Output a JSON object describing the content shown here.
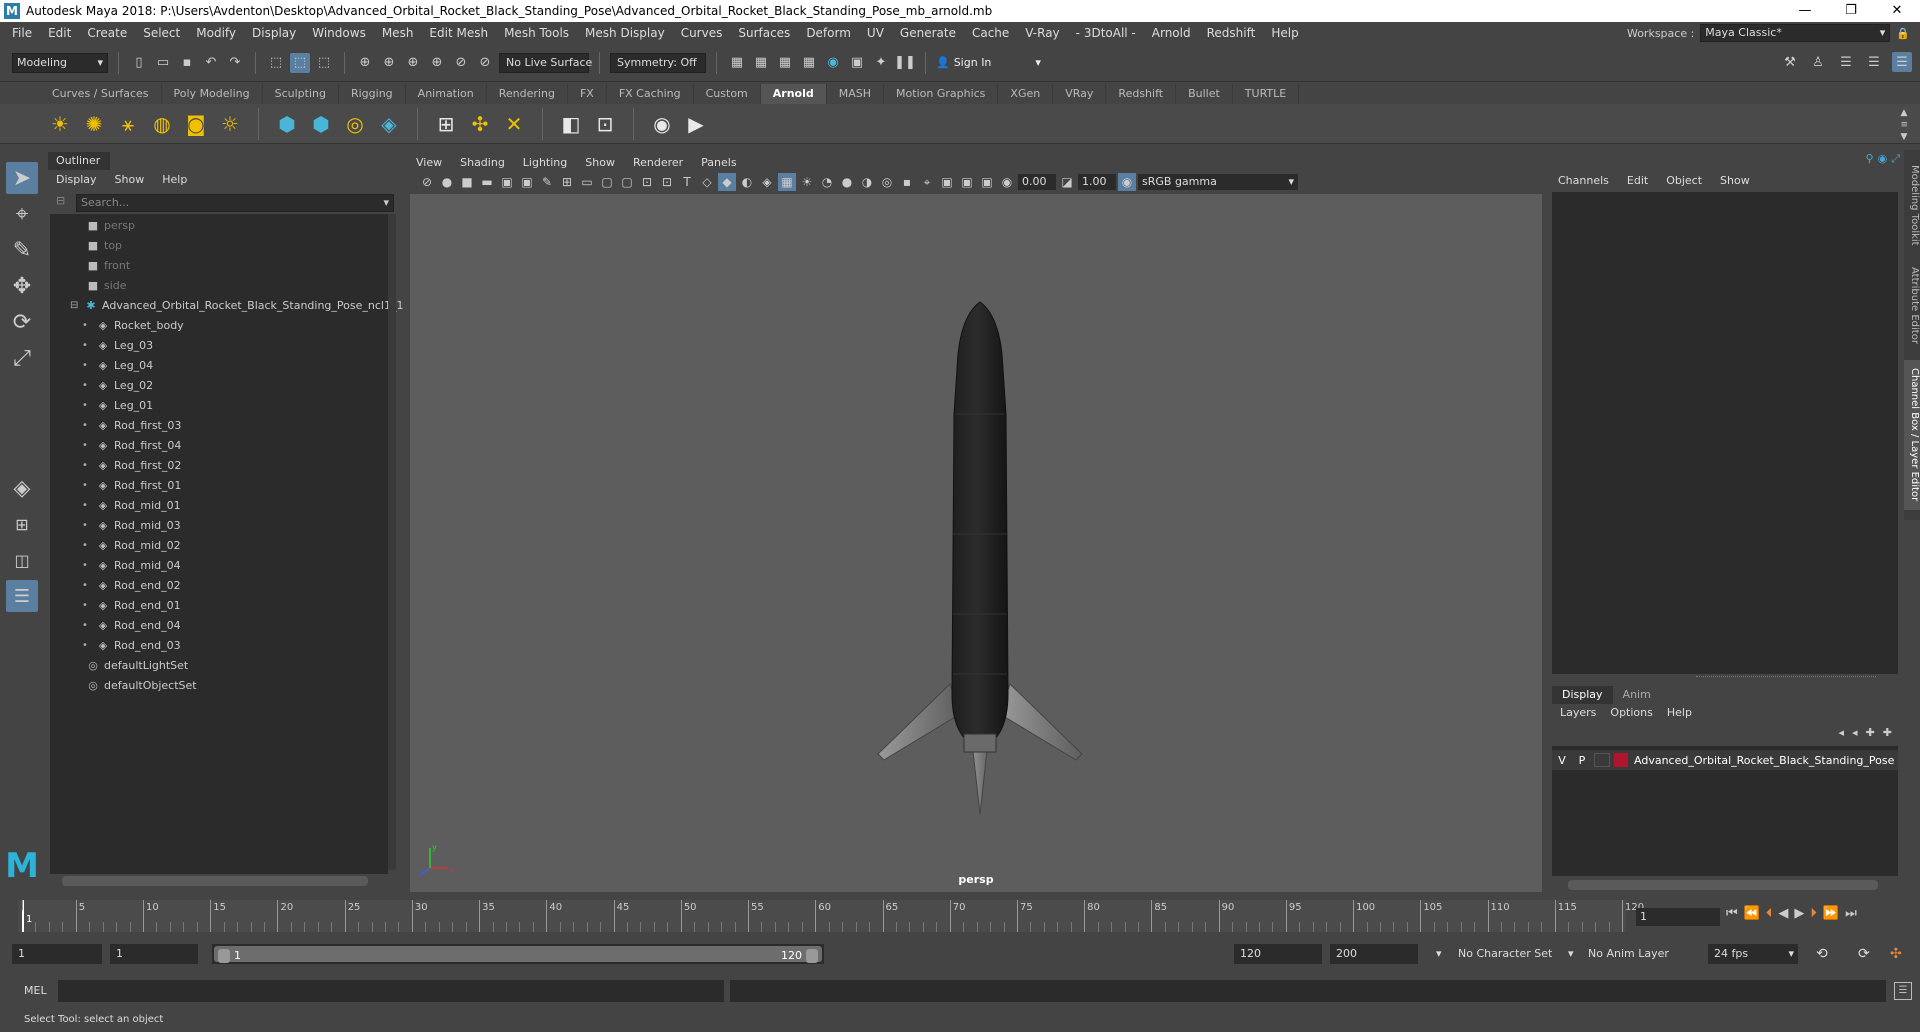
{
  "window": {
    "app_icon": "M",
    "title": "Autodesk Maya 2018: P:\\Users\\Avdenton\\Desktop\\Advanced_Orbital_Rocket_Black_Standing_Pose\\Advanced_Orbital_Rocket_Black_Standing_Pose_mb_arnold.mb",
    "controls": [
      "—",
      "❐",
      "✕"
    ]
  },
  "menubar": {
    "items": [
      "File",
      "Edit",
      "Create",
      "Select",
      "Modify",
      "Display",
      "Windows",
      "Mesh",
      "Edit Mesh",
      "Mesh Tools",
      "Mesh Display",
      "Curves",
      "Surfaces",
      "Deform",
      "UV",
      "Generate",
      "Cache",
      "V-Ray",
      "- 3DtoAll -",
      "Arnold",
      "Redshift",
      "Help"
    ],
    "workspace_label": "Workspace :",
    "workspace_value": "Maya Classic*"
  },
  "statusline": {
    "mode": "Modeling",
    "live_surface": "No Live Surface",
    "symmetry": "Symmetry: Off",
    "sign_in": "Sign In"
  },
  "shelf": {
    "tabs": [
      "Curves / Surfaces",
      "Poly Modeling",
      "Sculpting",
      "Rigging",
      "Animation",
      "Rendering",
      "FX",
      "FX Caching",
      "Custom",
      "Arnold",
      "MASH",
      "Motion Graphics",
      "XGen",
      "VRay",
      "Redshift",
      "Bullet",
      "TURTLE"
    ],
    "active_tab": "Arnold"
  },
  "outliner": {
    "tab": "Outliner",
    "menu": [
      "Display",
      "Show",
      "Help"
    ],
    "search_placeholder": "Search...",
    "cameras": [
      "persp",
      "top",
      "front",
      "side"
    ],
    "group": "Advanced_Orbital_Rocket_Black_Standing_Pose_ncl1_1",
    "children": [
      "Rocket_body",
      "Leg_03",
      "Leg_04",
      "Leg_02",
      "Leg_01",
      "Rod_first_03",
      "Rod_first_04",
      "Rod_first_02",
      "Rod_first_01",
      "Rod_mid_01",
      "Rod_mid_03",
      "Rod_mid_02",
      "Rod_mid_04",
      "Rod_end_02",
      "Rod_end_01",
      "Rod_end_04",
      "Rod_end_03"
    ],
    "sets": [
      "defaultLightSet",
      "defaultObjectSet"
    ]
  },
  "viewport": {
    "menu": [
      "View",
      "Shading",
      "Lighting",
      "Show",
      "Renderer",
      "Panels"
    ],
    "exposure": "0.00",
    "gamma": "1.00",
    "color_space": "sRGB gamma",
    "camera": "persp",
    "axis_labels": {
      "x": "x",
      "y": "y",
      "z": "z"
    }
  },
  "channelbox": {
    "menu": [
      "Channels",
      "Edit",
      "Object",
      "Show"
    ],
    "layer_tabs": [
      "Display",
      "Anim"
    ],
    "layer_menu": [
      "Layers",
      "Options",
      "Help"
    ],
    "layer": {
      "v": "V",
      "p": "P",
      "name": "Advanced_Orbital_Rocket_Black_Standing_Pose",
      "color": "#b0152f"
    }
  },
  "side_tabs": [
    "Modeling Toolkit",
    "Attribute Editor",
    "Channel Box / Layer Editor"
  ],
  "timeslider": {
    "ticks": [
      1,
      5,
      10,
      15,
      20,
      25,
      30,
      35,
      40,
      45,
      50,
      55,
      60,
      65,
      70,
      75,
      80,
      85,
      90,
      95,
      100,
      105,
      110,
      115,
      120
    ],
    "current_frame": "1",
    "frame_field": "1"
  },
  "rangeslider": {
    "start_field": "1",
    "anim_start_field": "1",
    "range_start": "1",
    "range_end": "120",
    "end_field": "120",
    "anim_end_field": "200",
    "character_set": "No Character Set",
    "anim_layer": "No Anim Layer",
    "fps": "24 fps"
  },
  "cmdline": {
    "mel": "MEL"
  },
  "helpline": {
    "text": "Select Tool: select an object"
  }
}
